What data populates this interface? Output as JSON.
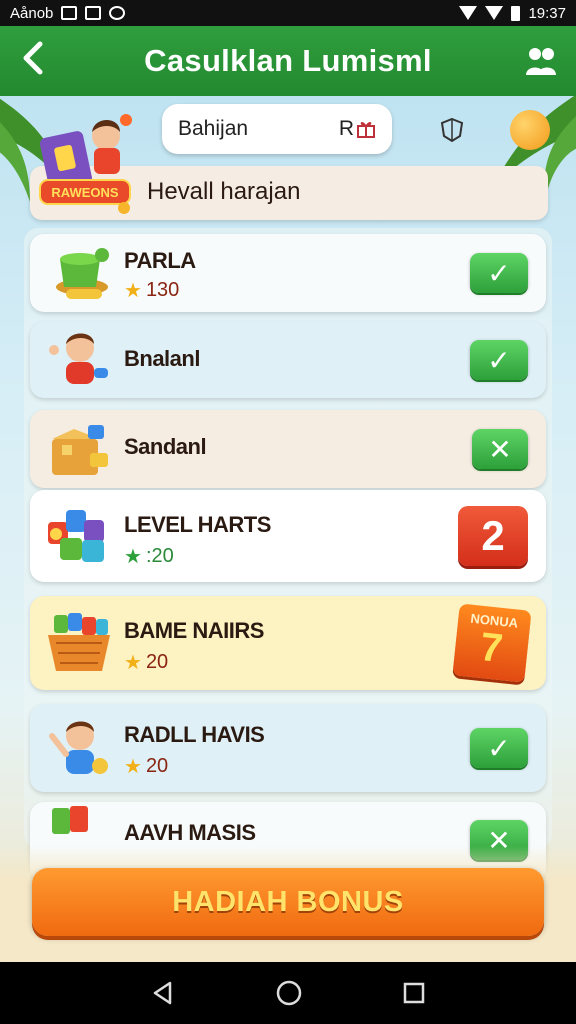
{
  "status_bar": {
    "carrier": "Aånob",
    "time": "19:37"
  },
  "app_bar": {
    "title": "Casulklan Lumisml",
    "back_icon": "arrow-left-icon",
    "right_icon": "people-icon",
    "color": "#2f9e3e"
  },
  "top": {
    "search_text": "Bahijan",
    "search_suffix": "R",
    "badge_text": "RAWEONS"
  },
  "header": {
    "label": "Hevall harajan"
  },
  "items": [
    {
      "name": "PARLA",
      "score": "130",
      "action": "check",
      "action_symbol": "✓"
    },
    {
      "name": "Bnalanl",
      "score": "",
      "action": "check",
      "action_symbol": "✓"
    },
    {
      "name": "Sandanl",
      "score": "",
      "action": "close",
      "action_symbol": "✕"
    },
    {
      "name": "LEVEL HARTS",
      "score": ":20",
      "action": "number",
      "action_value": "2"
    },
    {
      "name": "BAME NAIIRS",
      "score": "20",
      "action": "bonus",
      "bonus_word": "NONUA",
      "action_value": "7"
    },
    {
      "name": "RADLL HAVIS",
      "score": "20",
      "action": "check",
      "action_symbol": "✓"
    },
    {
      "name": "AAVH MASIS",
      "score": "",
      "action": "close",
      "action_symbol": "✕"
    }
  ],
  "cta": {
    "label": "HADIAH BONUS",
    "color": "#f06a10"
  }
}
